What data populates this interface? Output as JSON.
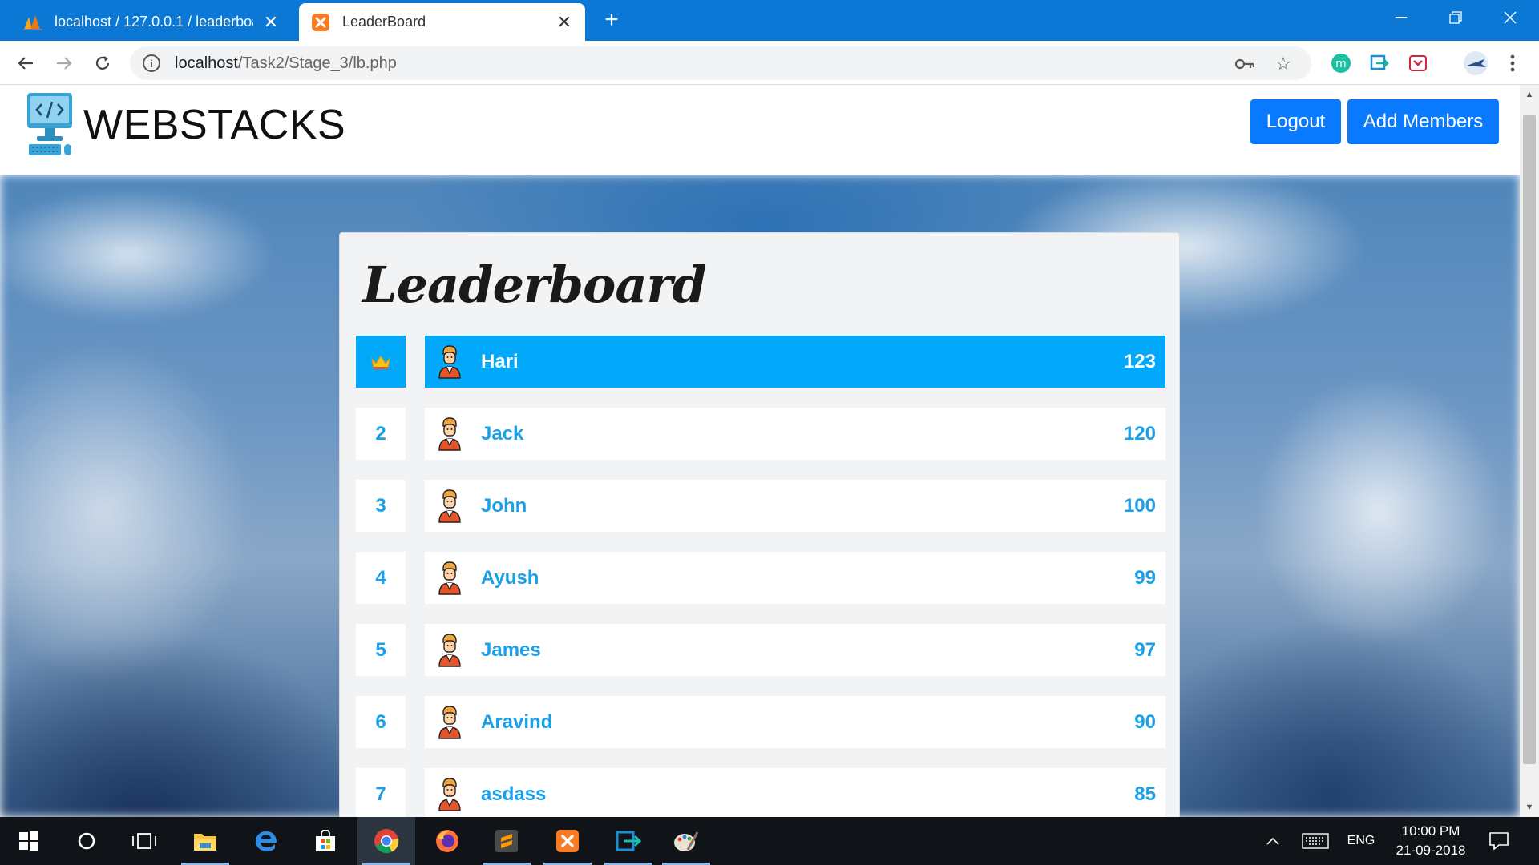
{
  "browser": {
    "tabs": [
      {
        "title": "localhost / 127.0.0.1 / leaderboard",
        "active": false
      },
      {
        "title": "LeaderBoard",
        "active": true
      }
    ],
    "new_tab_label": "+",
    "url_host": "localhost",
    "url_path": "/Task2/Stage_3/lb.php"
  },
  "site": {
    "brand": "WEBSTACKS",
    "logout_label": "Logout",
    "add_members_label": "Add Members"
  },
  "leaderboard": {
    "title": "Leaderboard",
    "rows": [
      {
        "rank": "crown",
        "name": "Hari",
        "score": "123"
      },
      {
        "rank": "2",
        "name": "Jack",
        "score": "120"
      },
      {
        "rank": "3",
        "name": "John",
        "score": "100"
      },
      {
        "rank": "4",
        "name": "Ayush",
        "score": "99"
      },
      {
        "rank": "5",
        "name": "James",
        "score": "97"
      },
      {
        "rank": "6",
        "name": "Aravind",
        "score": "90"
      },
      {
        "rank": "7",
        "name": "asdass",
        "score": "85"
      }
    ]
  },
  "taskbar": {
    "language": "ENG",
    "time": "10:00 PM",
    "date": "21-09-2018"
  },
  "colors": {
    "accent": "#02a9fb",
    "text_accent": "#1aa0e8",
    "button": "#0a7bff",
    "tabbar": "#0a78d4"
  }
}
